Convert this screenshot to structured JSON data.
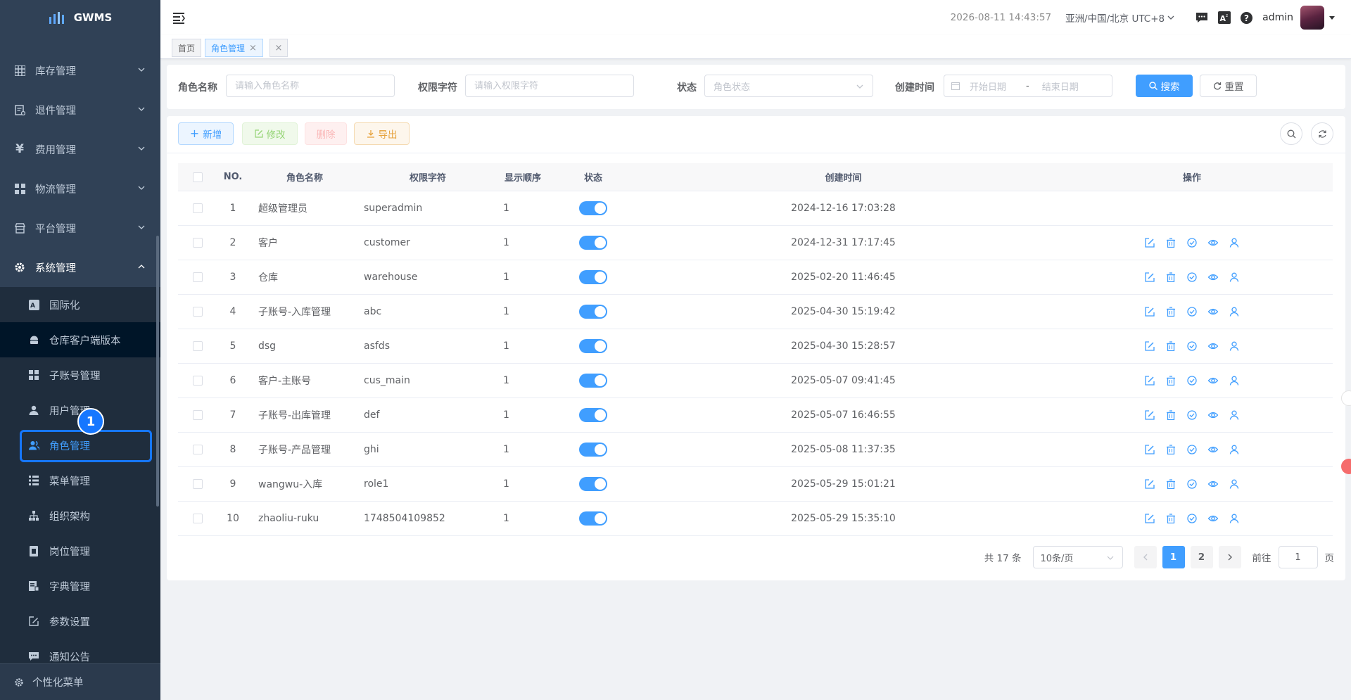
{
  "app": {
    "name": "GWMS"
  },
  "sidebar": {
    "menu": [
      {
        "label": "库存管理",
        "icon": "grid-icon"
      },
      {
        "label": "退件管理",
        "icon": "return-doc-icon"
      },
      {
        "label": "费用管理",
        "icon": "yen-icon"
      },
      {
        "label": "物流管理",
        "icon": "apps-icon"
      },
      {
        "label": "平台管理",
        "icon": "store-icon"
      },
      {
        "label": "系统管理",
        "icon": "gear-icon"
      }
    ],
    "submenu": [
      {
        "label": "国际化",
        "icon": "translate-icon"
      },
      {
        "label": "仓库客户端版本",
        "icon": "android-icon"
      },
      {
        "label": "子账号管理",
        "icon": "apps-icon"
      },
      {
        "label": "用户管理",
        "icon": "user-icon"
      },
      {
        "label": "角色管理",
        "icon": "users-icon"
      },
      {
        "label": "菜单管理",
        "icon": "list-icon"
      },
      {
        "label": "组织架构",
        "icon": "tree-icon"
      },
      {
        "label": "岗位管理",
        "icon": "badge-icon"
      },
      {
        "label": "字典管理",
        "icon": "dict-icon"
      },
      {
        "label": "参数设置",
        "icon": "edit-icon"
      },
      {
        "label": "通知公告",
        "icon": "message-icon"
      }
    ],
    "footer": "个性化菜单",
    "step_badge": "1"
  },
  "navbar": {
    "datetime": "2026-08-11 14:43:57",
    "timezone": "亚洲/中国/北京 UTC+8",
    "username": "admin"
  },
  "tags": {
    "home": "首页",
    "active": "角色管理",
    "close_all": "×"
  },
  "search": {
    "role_name_label": "角色名称",
    "role_name_placeholder": "请输入角色名称",
    "perm_label": "权限字符",
    "perm_placeholder": "请输入权限字符",
    "status_label": "状态",
    "status_placeholder": "角色状态",
    "created_label": "创建时间",
    "start_placeholder": "开始日期",
    "range_sep": "-",
    "end_placeholder": "结束日期",
    "search_btn": "搜索",
    "reset_btn": "重置"
  },
  "toolbar": {
    "add": "新增",
    "edit": "修改",
    "delete": "删除",
    "export": "导出"
  },
  "table": {
    "headers": {
      "no": "NO.",
      "name": "角色名称",
      "key": "权限字符",
      "sort": "显示顺序",
      "status": "状态",
      "created": "创建时间",
      "ops": "操作"
    },
    "rows": [
      {
        "no": "1",
        "name": "超级管理员",
        "key": "superadmin",
        "sort": "1",
        "enabled": true,
        "created": "2024-12-16 17:03:28",
        "ops": false
      },
      {
        "no": "2",
        "name": "客户",
        "key": "customer",
        "sort": "1",
        "enabled": true,
        "created": "2024-12-31 17:17:45",
        "ops": true
      },
      {
        "no": "3",
        "name": "仓库",
        "key": "warehouse",
        "sort": "1",
        "enabled": true,
        "created": "2025-02-20 11:46:45",
        "ops": true
      },
      {
        "no": "4",
        "name": "子账号-入库管理",
        "key": "abc",
        "sort": "1",
        "enabled": true,
        "created": "2025-04-30 15:19:42",
        "ops": true
      },
      {
        "no": "5",
        "name": "dsg",
        "key": "asfds",
        "sort": "1",
        "enabled": true,
        "created": "2025-04-30 15:28:57",
        "ops": true
      },
      {
        "no": "6",
        "name": "客户-主账号",
        "key": "cus_main",
        "sort": "1",
        "enabled": true,
        "created": "2025-05-07 09:41:45",
        "ops": true
      },
      {
        "no": "7",
        "name": "子账号-出库管理",
        "key": "def",
        "sort": "1",
        "enabled": true,
        "created": "2025-05-07 16:46:55",
        "ops": true
      },
      {
        "no": "8",
        "name": "子账号-产品管理",
        "key": "ghi",
        "sort": "1",
        "enabled": true,
        "created": "2025-05-08 11:37:35",
        "ops": true
      },
      {
        "no": "9",
        "name": "wangwu-入库",
        "key": "role1",
        "sort": "1",
        "enabled": true,
        "created": "2025-05-29 15:01:21",
        "ops": true
      },
      {
        "no": "10",
        "name": "zhaoliu-ruku",
        "key": "1748504109852",
        "sort": "1",
        "enabled": true,
        "created": "2025-05-29 15:35:10",
        "ops": true
      }
    ]
  },
  "pagination": {
    "total": "共 17 条",
    "page_size": "10条/页",
    "pages": [
      "1",
      "2"
    ],
    "current": "1",
    "goto_label": "前往",
    "goto_value": "1",
    "page_unit": "页"
  },
  "colors": {
    "primary": "#409eff",
    "sidebar_bg": "#304156",
    "highlight": "#1677ff"
  }
}
